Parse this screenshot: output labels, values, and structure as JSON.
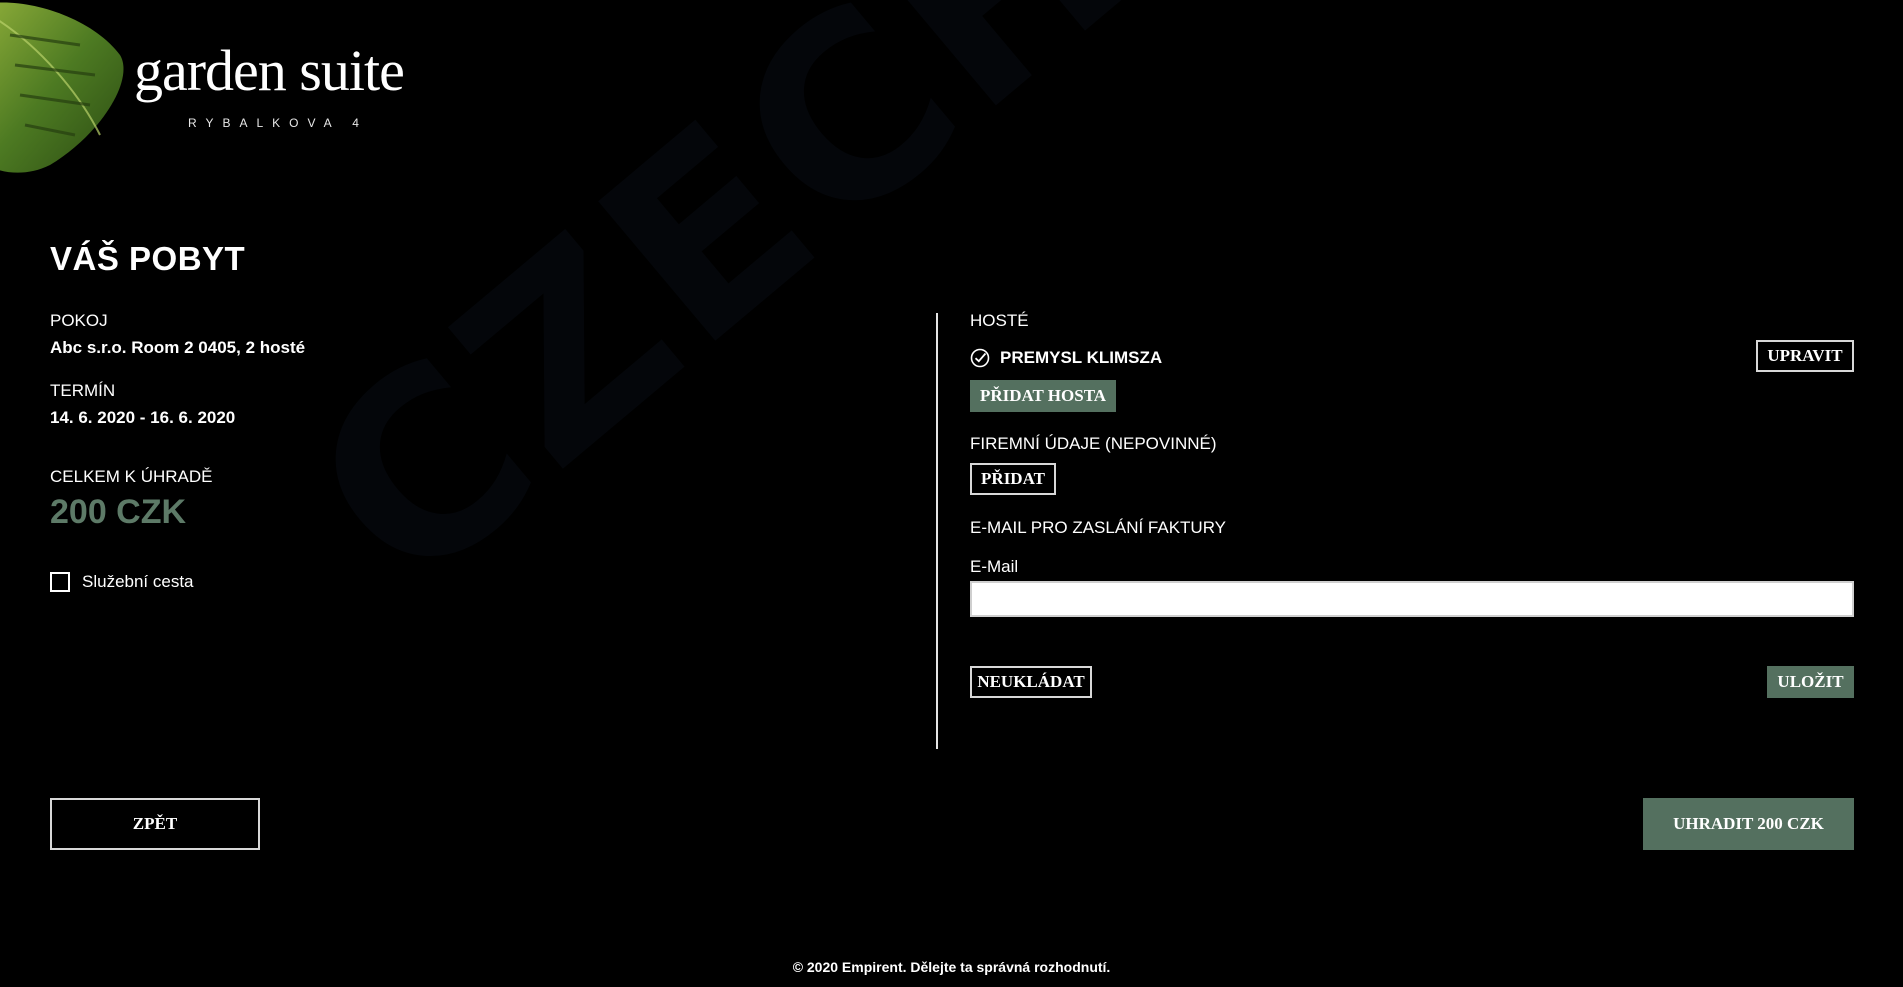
{
  "brand": {
    "title": "garden suite",
    "subtitle": "RYBALKOVA 4"
  },
  "watermark": "CZECH KIOSK",
  "stay": {
    "heading": "VÁŠ POBYT",
    "room_label": "POKOJ",
    "room_value": "Abc s.r.o. Room 2 0405, 2 hosté",
    "term_label": "TERMÍN",
    "term_value": "14. 6. 2020 - 16. 6. 2020",
    "total_label": "CELKEM K ÚHRADĚ",
    "total_value": "200 CZK",
    "business_trip_label": "Služební cesta",
    "business_trip_checked": false
  },
  "guests": {
    "label": "HOSTÉ",
    "items": [
      {
        "name": "PREMYSL KLIMSZA",
        "edit_label": "UPRAVIT"
      }
    ],
    "add_guest_label": "PŘIDAT HOSTA"
  },
  "company": {
    "label": "FIREMNÍ ÚDAJE (NEPOVINNÉ)",
    "add_label": "PŘIDAT"
  },
  "invoice_email": {
    "label": "E-MAIL PRO ZASLÁNÍ FAKTURY",
    "field_label": "E-Mail",
    "value": "",
    "placeholder": ""
  },
  "actions": {
    "discard_label": "NEUKLÁDAT",
    "save_label": "ULOŽIT",
    "back_label": "ZPĚT",
    "pay_label": "UHRADIT 200 CZK"
  },
  "footer": {
    "text": "© 2020 Empirent. Dělejte ta správná rozhodnutí."
  },
  "colors": {
    "accent": "#54705f",
    "price": "#5d7a67",
    "background": "#000000",
    "text": "#ffffff"
  }
}
